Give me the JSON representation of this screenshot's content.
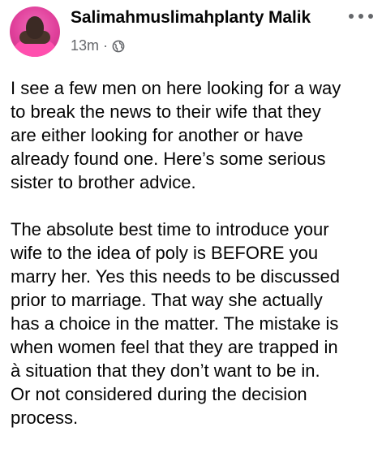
{
  "post": {
    "author_name": "Salimahmuslimahplanty Malik",
    "timestamp": "13m",
    "separator": "·",
    "audience_icon": "globe-icon",
    "more_icon": "more-horizontal-icon",
    "avatar_colors": {
      "background": "#e0409b",
      "shirt": "#ff4fae"
    },
    "paragraph_1_lines": [
      "I see a few men on here looking for a way",
      "to break the news to their wife that they",
      "are either looking for another or have",
      "already found one. Here’s some serious",
      "sister to brother advice."
    ],
    "paragraph_2_lines": [
      "The absolute best time to introduce your",
      "wife to the idea of poly is BEFORE you",
      "marry her. Yes this needs to be discussed",
      "prior to marriage. That way she actually",
      "has a choice in the matter. The mistake is",
      "when women feel that they are trapped in",
      "à situation that they don’t want to be in.",
      "Or not considered during the decision",
      "process."
    ]
  }
}
